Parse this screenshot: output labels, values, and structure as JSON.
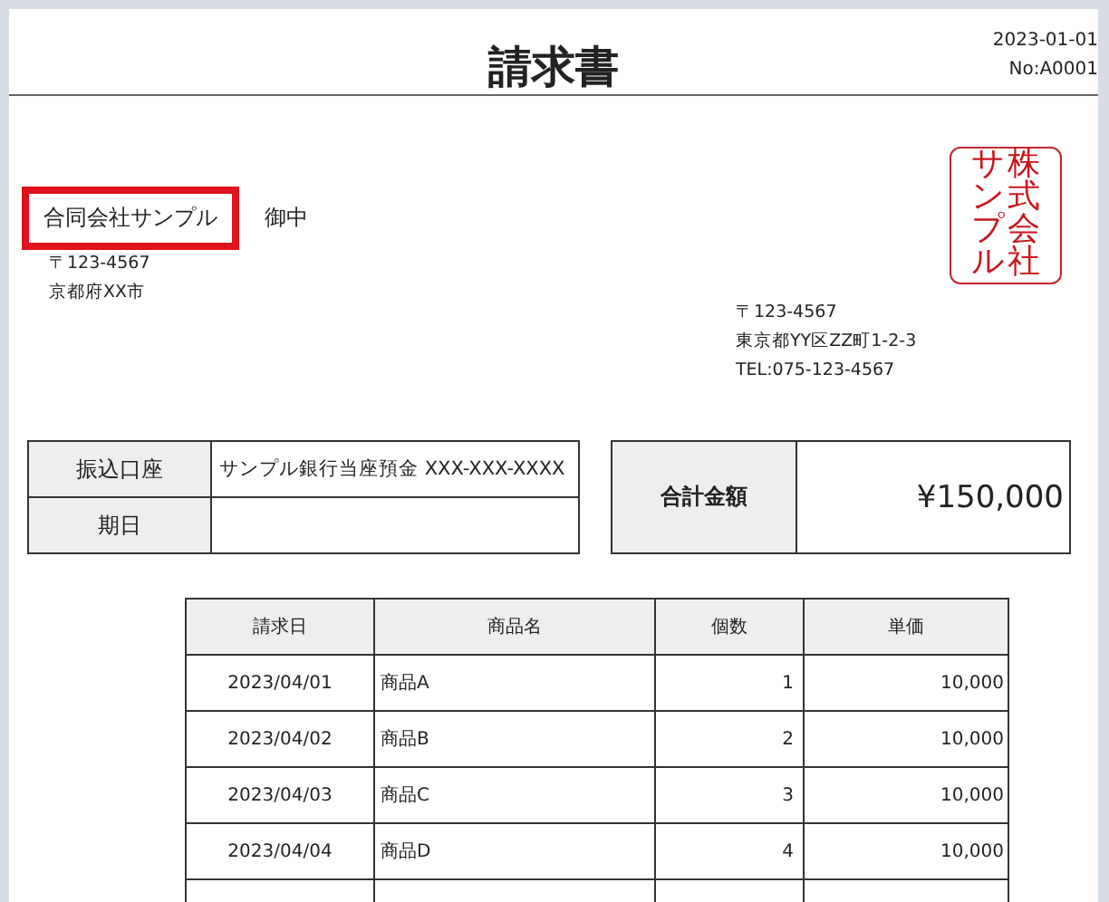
{
  "title": "請求書",
  "date": "2023-01-01",
  "number": "No:A0001",
  "client": {
    "name": "合同会社サンプル",
    "highlighted": true,
    "honorific": "御中",
    "postal": "〒123-4567",
    "address": "京都府XX市"
  },
  "stamp": {
    "columns": [
      "サンプル",
      "株式会社"
    ]
  },
  "issuer": {
    "postal": "〒123-4567",
    "address": "東京都YY区ZZ町1-2-3",
    "tel": "TEL:075-123-4567"
  },
  "payment": [
    {
      "label": "振込口座",
      "value": "サンプル銀行当座預金 XXX-XXX-XXXX"
    },
    {
      "label": "期日"
    }
  ],
  "total": {
    "label": "合計金額",
    "value": "¥150,000"
  },
  "table": {
    "columns": [
      "請求日",
      "商品名",
      "個数",
      "単価"
    ],
    "rows": [
      [
        "2023/04/01",
        "商品A",
        "1",
        "10,000"
      ],
      [
        "2023/04/02",
        "商品B",
        "2",
        "10,000"
      ],
      [
        "2023/04/03",
        "商品C",
        "3",
        "10,000"
      ],
      [
        "2023/04/04",
        "商品D",
        "4",
        "10,000"
      ]
    ]
  }
}
